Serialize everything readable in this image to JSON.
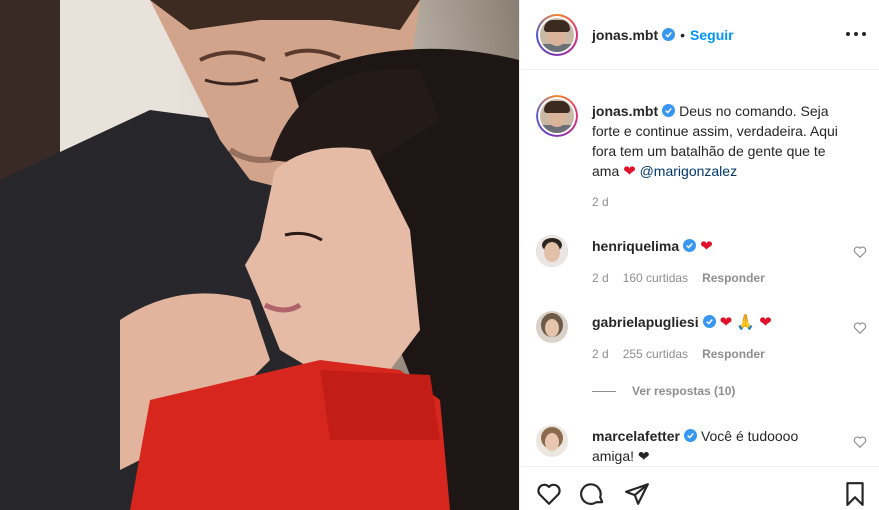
{
  "post": {
    "username": "jonas.mbt",
    "dot": "•",
    "follow_label": "Seguir"
  },
  "caption": {
    "username": "jonas.mbt",
    "text": "Deus no comando. Seja forte e continue assim, verdadeira. Aqui fora tem um batalhão de gente que te ama",
    "heart": "❤",
    "mention": "@marigonzalez",
    "time": "2 d"
  },
  "comments": [
    {
      "username": "henriquelima",
      "text": "",
      "emoji": "❤",
      "time": "2 d",
      "likes": "160 curtidas",
      "reply_label": "Responder"
    },
    {
      "username": "gabrielapugliesi",
      "text": "",
      "emoji": "❤ 🙏 ❤",
      "time": "2 d",
      "likes": "255 curtidas",
      "reply_label": "Responder"
    },
    {
      "username": "marcelafetter",
      "text": "Você é tudoooo amiga!",
      "emoji": "❤",
      "time": "",
      "likes": "",
      "reply_label": ""
    }
  ],
  "view_replies_label": "Ver respostas (10)",
  "colors": {
    "accent": "#0095f6",
    "verified": "#3897f0",
    "heart": "#e0112b",
    "muted": "#8e8e8e",
    "sweater": "#d7261e"
  },
  "icons": [
    "heart-icon",
    "comment-icon",
    "share-icon",
    "bookmark-icon",
    "more-options-icon",
    "verified-badge-icon"
  ]
}
